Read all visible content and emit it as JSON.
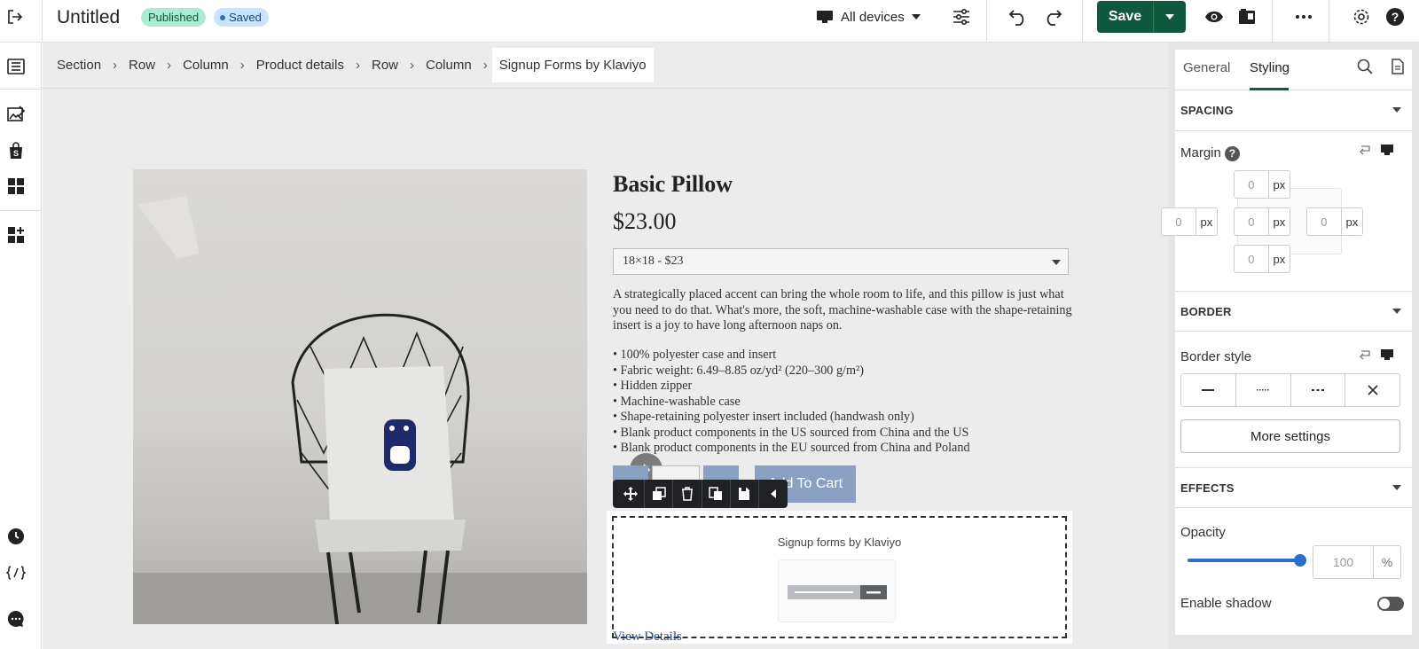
{
  "header": {
    "title": "Untitled",
    "status_published": "Published",
    "status_saved": "Saved",
    "device_label": "All devices",
    "save_label": "Save"
  },
  "breadcrumb": [
    "Section",
    "Row",
    "Column",
    "Product details",
    "Row",
    "Column",
    "Signup Forms by Klaviyo"
  ],
  "product": {
    "title": "Basic Pillow",
    "price": "$23.00",
    "variant": "18×18 - $23",
    "description": "A strategically placed accent can bring the whole room to life, and this pillow is just what you need to do that. What's more, the soft, machine-washable case with the shape-retaining insert is a joy to have long afternoon naps on.",
    "bullets": [
      "• 100% polyester case and insert",
      "• Fabric weight: 6.49–8.85 oz/yd² (220–300 g/m²)",
      "• Hidden zipper",
      "• Machine-washable case",
      "• Shape-retaining polyester insert included (handwash only)",
      "• Blank product components in the US sourced from China and the US",
      "• Blank product components in the EU sourced from China and Poland"
    ],
    "add_to_cart": "Add To Cart",
    "view_details": "View Details"
  },
  "signup_block": {
    "label": "Signup forms by Klaviyo"
  },
  "panel": {
    "tabs": [
      "General",
      "Styling"
    ],
    "active_tab": "Styling",
    "spacing_header": "SPACING",
    "margin_label": "Margin",
    "help_glyph": "?",
    "margin": {
      "top": "0",
      "left": "0",
      "center": "0",
      "right": "0",
      "bottom": "0",
      "unit": "px"
    },
    "border_header": "BORDER",
    "border_style_label": "Border style",
    "more_settings": "More settings",
    "effects_header": "EFFECTS",
    "opacity_label": "Opacity",
    "opacity_value": "100",
    "opacity_unit": "%",
    "opacity_fraction": 1.0,
    "enable_shadow_label": "Enable shadow",
    "enable_shadow": false
  },
  "colors": {
    "save_green": "#0f5a3e",
    "accent_blue": "#2c6ecb",
    "published_bg": "#aee9d1",
    "saved_bg": "#c6e4ff"
  }
}
